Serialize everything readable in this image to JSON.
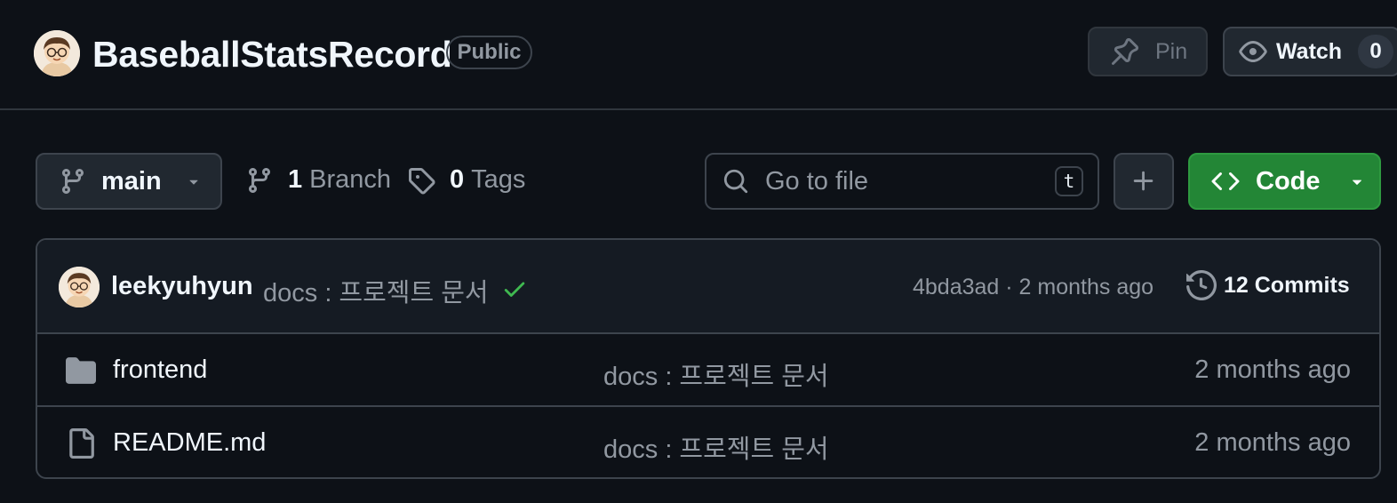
{
  "header": {
    "repo_name": "BaseballStatsRecord",
    "visibility": "Public",
    "pin_label": "Pin",
    "watch_label": "Watch",
    "watch_count": "0"
  },
  "toolbar": {
    "branch_name": "main",
    "branch_count": "1",
    "branch_label": "Branch",
    "tag_count": "0",
    "tag_label": "Tags",
    "search_placeholder": "Go to file",
    "search_shortcut": "t",
    "code_label": "Code"
  },
  "latest_commit": {
    "author": "leekyuhyun",
    "message": "docs : 프로젝트 문서",
    "status": "success",
    "meta": "4bda3ad · 2 months ago",
    "commits_label": "12 Commits"
  },
  "files": [
    {
      "name": "frontend",
      "type": "folder",
      "message": "docs : 프로젝트 문서",
      "date": "2 months ago"
    },
    {
      "name": "README.md",
      "type": "file",
      "message": "docs : 프로젝트 문서",
      "date": "2 months ago"
    }
  ],
  "colors": {
    "background": "#0d1117",
    "code_button": "#238636",
    "success": "#3fb950"
  }
}
